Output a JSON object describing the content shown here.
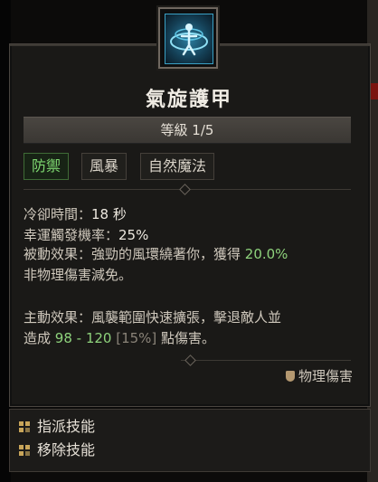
{
  "skill": {
    "icon": "whirlwind-armor-icon",
    "title": "氣旋護甲",
    "rank": "等級 1/5"
  },
  "tags": [
    "防禦",
    "風暴",
    "自然魔法"
  ],
  "stats": {
    "cooldown_label": "冷卻時間：",
    "cooldown_value": "18 秒",
    "lucky_label": "幸運觸發機率：",
    "lucky_value": "25%"
  },
  "passive": {
    "prefix": "被動效果：強勁的風環繞著你，獲得 ",
    "value": "20.0%",
    "line2": "非物理傷害減免。"
  },
  "active": {
    "line1": "主動效果：風襲範圍快速擴張，擊退敵人並",
    "prefix": "造成 ",
    "range": "98 - 120",
    "bracket": "[15%]",
    "suffix": " 點傷害。"
  },
  "damage_type": {
    "icon": "physical-damage-icon",
    "label": "物理傷害"
  },
  "actions": [
    {
      "icon": "assign-skill-icon",
      "label": "指派技能"
    },
    {
      "icon": "remove-skill-icon",
      "label": "移除技能"
    }
  ],
  "colors": {
    "active_tag": "#7ed870",
    "value_green": "#8ed27c",
    "panel_bg": "#1a1917"
  }
}
